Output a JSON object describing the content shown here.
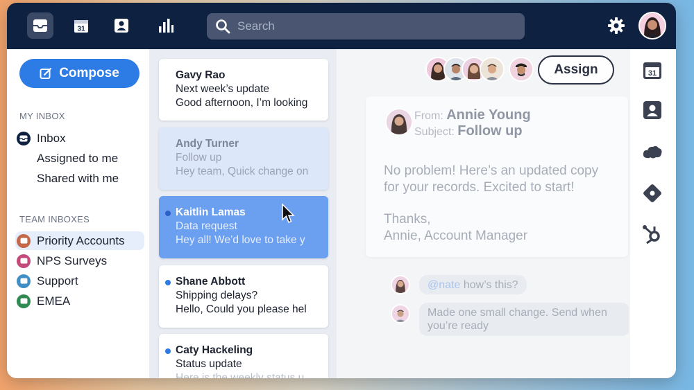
{
  "header": {
    "nav_icons": [
      "inbox-icon",
      "calendar-icon",
      "contacts-icon",
      "analytics-icon"
    ],
    "calendar_day": "31",
    "search_placeholder": "Search"
  },
  "sidebar": {
    "compose_label": "Compose",
    "my_inbox_title": "MY INBOX",
    "my_inbox": [
      {
        "label": "Inbox"
      },
      {
        "label": "Assigned to me"
      },
      {
        "label": "Shared with me"
      }
    ],
    "team_inboxes_title": "TEAM INBOXES",
    "team_inboxes": [
      {
        "label": "Priority Accounts",
        "color": "#c4684a",
        "selected": true
      },
      {
        "label": "NPS Surveys",
        "color": "#c44a7c"
      },
      {
        "label": "Support",
        "color": "#3f8fc6"
      },
      {
        "label": "EMEA",
        "color": "#2f8a52"
      }
    ]
  },
  "messages": [
    {
      "sender": "Gavy Rao",
      "subject": "Next week’s update",
      "preview": "Good afternoon, I’m looking",
      "unread": false,
      "state": "normal"
    },
    {
      "sender": "Andy Turner",
      "subject": "Follow up",
      "preview": "Hey team, Quick change on",
      "unread": false,
      "state": "faded"
    },
    {
      "sender": "Kaitlin Lamas",
      "subject": "Data request",
      "preview": "Hey all! We’d love to take y",
      "unread": true,
      "state": "active"
    },
    {
      "sender": "Shane Abbott",
      "subject": "Shipping delays?",
      "preview": "Hello, Could you please hel",
      "unread": true,
      "state": "normal"
    },
    {
      "sender": "Caty Hackeling",
      "subject": "Status update",
      "preview": "Here is the weekly status u",
      "unread": true,
      "state": "normal"
    }
  ],
  "detail": {
    "assign_label": "Assign",
    "from_label": "From:",
    "from_name": "Annie Young",
    "subject_label": "Subject:",
    "subject": "Follow up",
    "body_lines": [
      "No problem! Here’s an updated copy",
      "for your records. Excited to start!",
      "",
      "Thanks,",
      "Annie, Account Manager"
    ],
    "comments": [
      {
        "mention": "@nate",
        "text": " how’s this?"
      },
      {
        "text_line1": "Made one small change. Send when",
        "text_line2": "you’re ready"
      }
    ]
  },
  "rail": {
    "icons": [
      "calendar-icon",
      "contact-card-icon",
      "salesforce-icon",
      "diamond-icon",
      "hubspot-icon"
    ],
    "calendar_day": "31"
  },
  "colors": {
    "topbar": "#0e2141",
    "accent": "#2d7be5",
    "active_card": "#6b9ff0"
  }
}
